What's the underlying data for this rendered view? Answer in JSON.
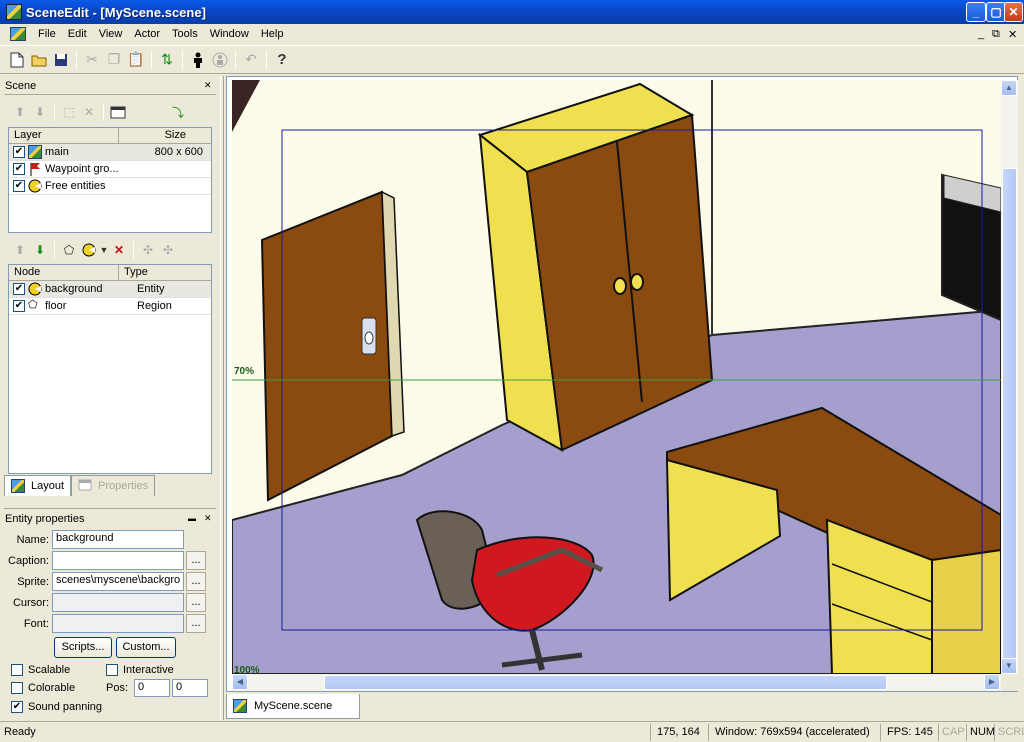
{
  "window": {
    "title": "SceneEdit - [MyScene.scene]",
    "controls": {
      "minimize": "_",
      "maximize": "▢",
      "close": "✕"
    }
  },
  "menu": {
    "items": [
      "File",
      "Edit",
      "View",
      "Actor",
      "Tools",
      "Window",
      "Help"
    ],
    "mdi_minimize": "_",
    "mdi_restore": "⧉",
    "mdi_close": "✕"
  },
  "toolbar": {
    "icons": [
      "new-icon",
      "open-icon",
      "save-icon",
      "cut-icon",
      "copy-icon",
      "paste-icon",
      "refresh-icon",
      "actor-icon",
      "actor-disabled-icon",
      "undo-icon",
      "help-icon"
    ],
    "help_label": "?"
  },
  "scene_panel": {
    "title": "Scene",
    "layer_columns": [
      "Layer",
      "Size"
    ],
    "layers": [
      {
        "name": "main",
        "size": "800 x 600",
        "checked": true
      },
      {
        "name": "Waypoint gro...",
        "size": "",
        "checked": true
      },
      {
        "name": "Free entities",
        "size": "",
        "checked": true
      }
    ],
    "node_columns": [
      "Node",
      "Type"
    ],
    "nodes": [
      {
        "name": "background",
        "type": "Entity",
        "checked": true
      },
      {
        "name": "floor",
        "type": "Region",
        "checked": true
      }
    ],
    "tabs": [
      {
        "label": "Layout",
        "active": true
      },
      {
        "label": "Properties",
        "active": false
      }
    ]
  },
  "entity_properties": {
    "title": "Entity properties",
    "fields": [
      {
        "label": "Name:",
        "value": "background"
      },
      {
        "label": "Caption:",
        "value": ""
      },
      {
        "label": "Sprite:",
        "value": "scenes\\myscene\\backgro"
      },
      {
        "label": "Cursor:",
        "value": ""
      },
      {
        "label": "Font:",
        "value": ""
      }
    ],
    "ellipsis": "...",
    "scripts_button": "Scripts...",
    "custom_button": "Custom...",
    "scalable_label": "Scalable",
    "scalable_checked": false,
    "interactive_label": "Interactive",
    "interactive_checked": false,
    "colorable_label": "Colorable",
    "colorable_checked": false,
    "pos_label": "Pos:",
    "pos_x": "0",
    "pos_y": "0",
    "sound_panning_label": "Sound panning",
    "sound_panning_checked": true
  },
  "canvas": {
    "scale_marker_top": "70%",
    "scale_marker_bottom": "100%"
  },
  "document_tab": {
    "label": "MyScene.scene"
  },
  "status_bar": {
    "status": "Ready",
    "coords": "175, 164",
    "window_info": "Window: 769x594 (accelerated)",
    "fps": "FPS: 145",
    "cap": "CAP",
    "num": "NUM",
    "scrl": "SCRL"
  },
  "colors": {
    "title_blue": "#0846c8",
    "wall": "#fcfbe9",
    "floor": "#a49fcc",
    "wood": "#8b4a10",
    "yellow": "#f0e050",
    "chair_red": "#d01820",
    "viewport_border": "#1a1aa0"
  }
}
